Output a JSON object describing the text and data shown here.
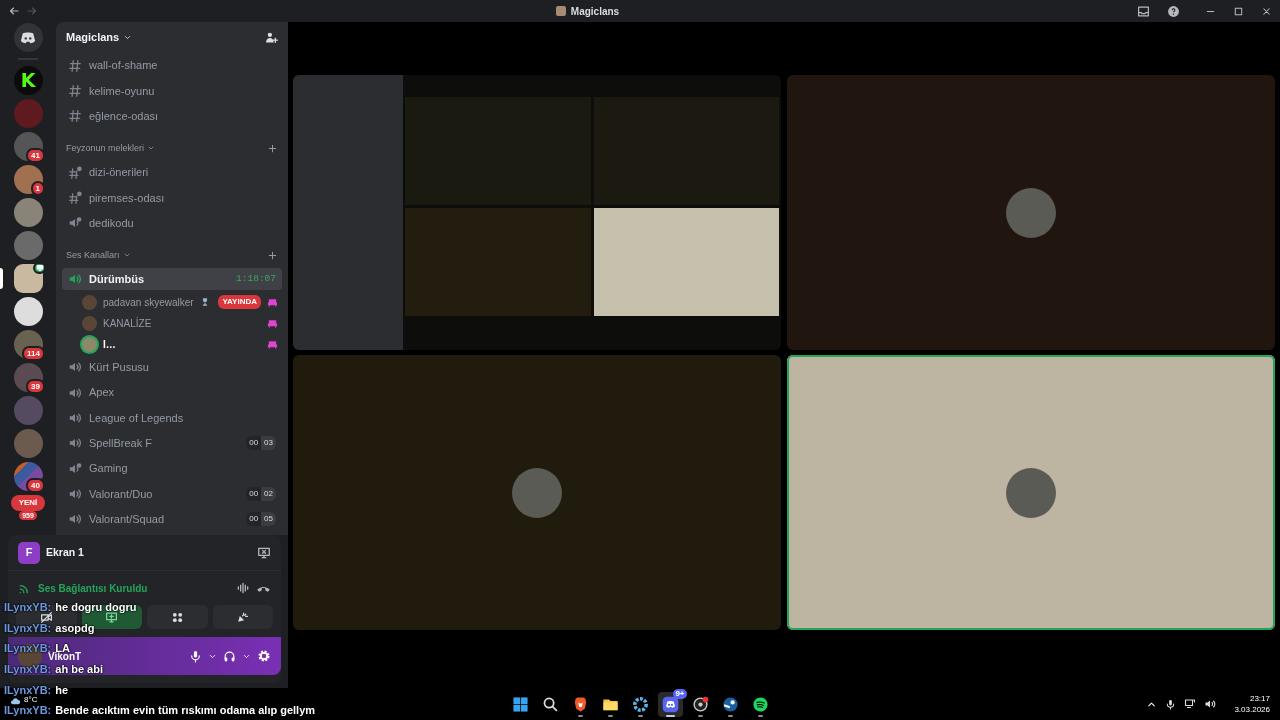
{
  "window": {
    "title": "Magiclans"
  },
  "servers": [
    {
      "kind": "home",
      "selected": false,
      "activity": false
    },
    {
      "kind": "letter",
      "initial": "K",
      "selected": false,
      "activity": false
    },
    {
      "kind": "photo",
      "selected": false,
      "activity": false
    },
    {
      "kind": "photo",
      "badge": "41",
      "selected": false,
      "activity": false
    },
    {
      "kind": "photo",
      "badge": "1",
      "selected": false,
      "activity": false
    },
    {
      "kind": "photo",
      "selected": false,
      "activity": false
    },
    {
      "kind": "photo",
      "selected": false,
      "activity": false
    },
    {
      "kind": "photo",
      "selected": true,
      "activity": true
    },
    {
      "kind": "photo",
      "selected": false,
      "activity": false
    },
    {
      "kind": "photo",
      "badge": "114",
      "selected": false,
      "activity": false
    },
    {
      "kind": "photo",
      "badge": "39",
      "selected": false,
      "activity": false
    },
    {
      "kind": "photo",
      "selected": false,
      "activity": false
    },
    {
      "kind": "photo",
      "selected": false,
      "activity": false
    },
    {
      "kind": "folder",
      "badge": "40",
      "selected": false,
      "activity": false
    },
    {
      "kind": "new",
      "label": "YENİ",
      "badge": "959",
      "selected": false,
      "activity": false
    }
  ],
  "sidebar": {
    "server_name": "Magiclans",
    "sections": [
      {
        "channels": [
          {
            "kind": "text",
            "name": "wall-of-shame",
            "selected": false
          },
          {
            "kind": "text",
            "name": "kelime-oyunu",
            "selected": false
          },
          {
            "kind": "text",
            "name": "eğlence-odası",
            "selected": false
          }
        ]
      },
      {
        "title": "Feyzonun melekleri",
        "channels": [
          {
            "kind": "text-locked",
            "name": "dizi-önerileri",
            "selected": false
          },
          {
            "kind": "text-locked",
            "name": "piremses-odası",
            "selected": false
          },
          {
            "kind": "voice-locked",
            "name": "dedikodu",
            "selected": false
          }
        ]
      },
      {
        "title": "Ses Kanalları",
        "channels": [
          {
            "kind": "voice",
            "name": "Dürümbüs",
            "selected": true,
            "timer": "1:18:07",
            "members": [
              {
                "name": "padavan skyewalker",
                "speaking": false,
                "tag": true,
                "live_label": "YAYINDA",
                "activity": true
              },
              {
                "name": "KANALİZE",
                "speaking": false,
                "tag": false,
                "activity": true
              },
              {
                "name": "I…",
                "speaking": true,
                "tag": false,
                "activity": true
              }
            ]
          },
          {
            "kind": "voice",
            "name": "Kürt Pususu",
            "selected": false
          },
          {
            "kind": "voice",
            "name": "Apex",
            "selected": false
          },
          {
            "kind": "voice",
            "name": "League of Legends",
            "selected": false
          },
          {
            "kind": "voice",
            "name": "SpellBreak F",
            "selected": false,
            "user_count": "00",
            "user_limit": "03"
          },
          {
            "kind": "voice-locked",
            "name": "Gaming",
            "selected": false
          },
          {
            "kind": "voice",
            "name": "Valorant/Duo",
            "selected": false,
            "user_count": "00",
            "user_limit": "02"
          },
          {
            "kind": "voice",
            "name": "Valorant/Squad",
            "selected": false,
            "user_count": "00",
            "user_limit": "05"
          }
        ]
      }
    ]
  },
  "stream_card": {
    "initial": "F",
    "title": "Ekran 1"
  },
  "voice_panel": {
    "status": "Ses Bağlantısı Kuruldu",
    "buttons": [
      {
        "kind": "camera",
        "selected": false
      },
      {
        "kind": "screen",
        "selected": true
      },
      {
        "kind": "activities",
        "selected": false
      },
      {
        "kind": "soundboard",
        "selected": false
      }
    ]
  },
  "user": {
    "name": "VikonT"
  },
  "chat_overlay": [
    {
      "author": "ILynxYB:",
      "text": "he dogru dogru"
    },
    {
      "author": "ILynxYB:",
      "text": "asopdg"
    },
    {
      "author": "ILynxYB:",
      "text": "LA"
    },
    {
      "author": "ILynxYB:",
      "text": "ah be abi"
    },
    {
      "author": "ILynxYB:",
      "text": "he"
    },
    {
      "author": "ILynxYB:",
      "text": "Bende acıktım evin tüm rıskımı odama alıp gellym"
    }
  ],
  "tiles": [
    {
      "kind": "stream",
      "speaking": false
    },
    {
      "kind": "participant",
      "color": "#20160f",
      "speaking": false
    },
    {
      "kind": "participant",
      "color": "#211b0e",
      "speaking": false
    },
    {
      "kind": "participant",
      "color": "#bdb4a2",
      "speaking": true
    }
  ],
  "taskbar": {
    "weather": "8°C",
    "apps": [
      {
        "kind": "start",
        "active": false
      },
      {
        "kind": "search",
        "active": false
      },
      {
        "kind": "browser",
        "active": false
      },
      {
        "kind": "folder",
        "active": false
      },
      {
        "kind": "app",
        "active": false
      },
      {
        "kind": "chat",
        "active": true,
        "badge": "9+"
      },
      {
        "kind": "recorder",
        "active": false
      },
      {
        "kind": "game",
        "active": false
      },
      {
        "kind": "music",
        "active": false
      }
    ],
    "time": "23:17",
    "date": "3.03.2026"
  }
}
